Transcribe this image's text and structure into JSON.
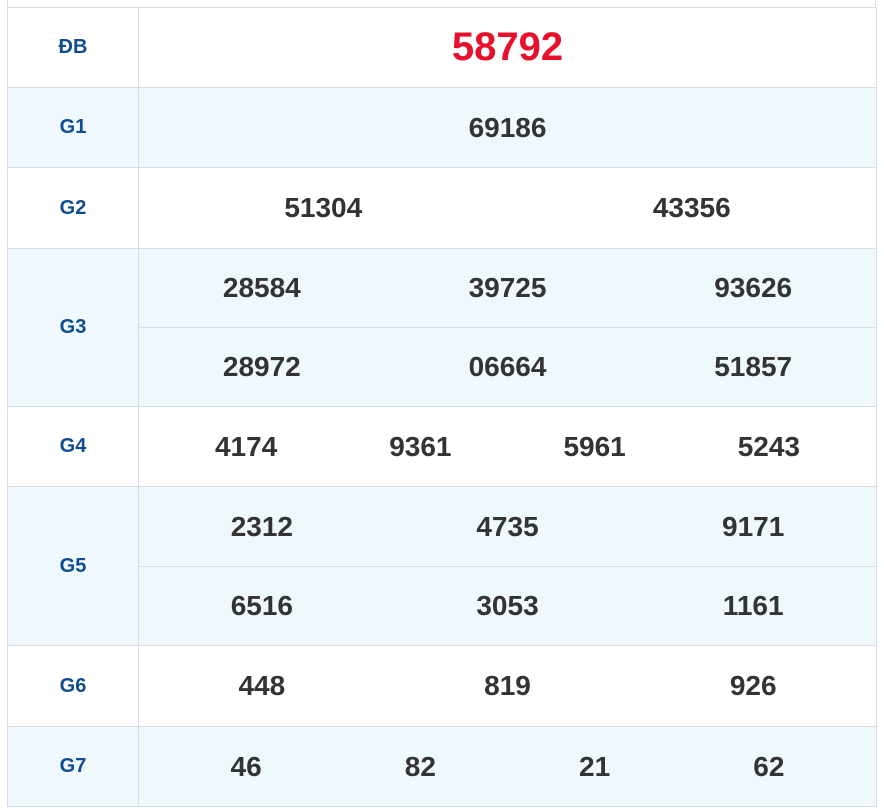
{
  "rows": [
    {
      "label": "ĐB",
      "lines": [
        [
          "58792"
        ]
      ],
      "special": true
    },
    {
      "label": "G1",
      "lines": [
        [
          "69186"
        ]
      ]
    },
    {
      "label": "G2",
      "lines": [
        [
          "51304",
          "43356"
        ]
      ]
    },
    {
      "label": "G3",
      "lines": [
        [
          "28584",
          "39725",
          "93626"
        ],
        [
          "28972",
          "06664",
          "51857"
        ]
      ]
    },
    {
      "label": "G4",
      "lines": [
        [
          "4174",
          "9361",
          "5961",
          "5243"
        ]
      ]
    },
    {
      "label": "G5",
      "lines": [
        [
          "2312",
          "4735",
          "9171"
        ],
        [
          "6516",
          "3053",
          "1161"
        ]
      ]
    },
    {
      "label": "G6",
      "lines": [
        [
          "448",
          "819",
          "926"
        ]
      ]
    },
    {
      "label": "G7",
      "lines": [
        [
          "46",
          "82",
          "21",
          "62"
        ]
      ]
    }
  ],
  "colors": {
    "label": "#0f4c92",
    "special": "#e8112d",
    "number": "#333333",
    "alt_row": "#eef8fd",
    "border": "#d7dde3"
  }
}
